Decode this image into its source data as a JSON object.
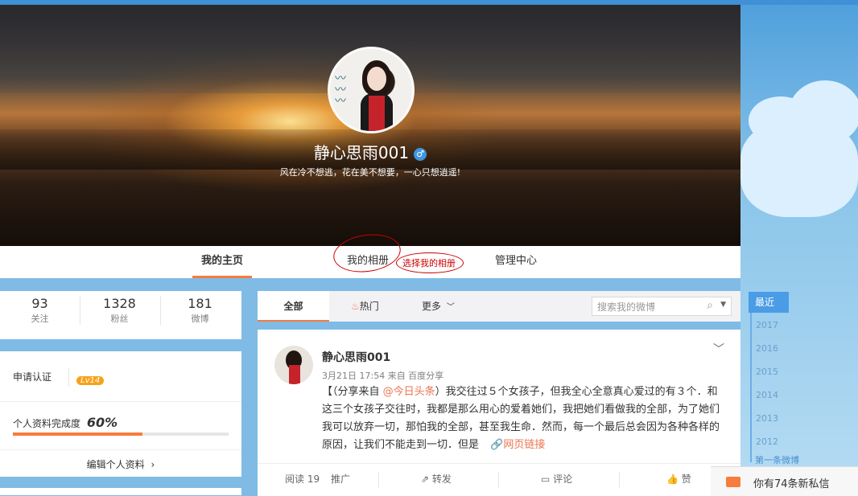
{
  "profile": {
    "name": "静心思雨001",
    "gender_symbol": "♂",
    "motto": "风在冷不想逃，花在美不想要，一心只想逍遥!"
  },
  "nav": {
    "home": "我的主页",
    "album": "我的相册",
    "admin": "管理中心",
    "annotation": "选择我的相册"
  },
  "stats": [
    {
      "value": "93",
      "label": "关注"
    },
    {
      "value": "1328",
      "label": "粉丝"
    },
    {
      "value": "181",
      "label": "微博"
    }
  ],
  "info": {
    "verify": "申请认证",
    "level": "Lv14",
    "completion_label": "个人资料完成度",
    "completion_value": "60%",
    "completion_fraction": 0.6,
    "edit": "编辑个人资料"
  },
  "feed_tabs": {
    "all": "全部",
    "hot": "热门",
    "more": "更多",
    "search_placeholder": "搜索我的微博"
  },
  "post": {
    "author": "静心思雨001",
    "meta": "3月21日 17:54 来自 百度分享",
    "body_pre": "【（分享来自 ",
    "mention": "@今日头条",
    "body_post": "）我交往过５个女孩子，但我全心全意真心爱过的有３个．和这三个女孩子交往时，我都是那么用心的爱着她们，我把她们看做我的全部，为了她们我可以放弃一切，那怕我的全部，甚至我生命．然而，每一个最后总会因为各种各样的原因，让我们不能走到一切．但是",
    "link": "网页链接",
    "reads": "阅读 19",
    "promote": "推广",
    "repost": "转发",
    "comment": "评论",
    "like": "赞"
  },
  "timeline": {
    "current": "最近",
    "years": [
      "2017",
      "2016",
      "2015",
      "2014",
      "2013",
      "2012"
    ],
    "first": "第一条微博"
  },
  "messages": {
    "text": "你有74条新私信"
  },
  "colors": {
    "accent": "#f77c3d",
    "link": "#eb7350",
    "annotation": "#cc0000"
  }
}
